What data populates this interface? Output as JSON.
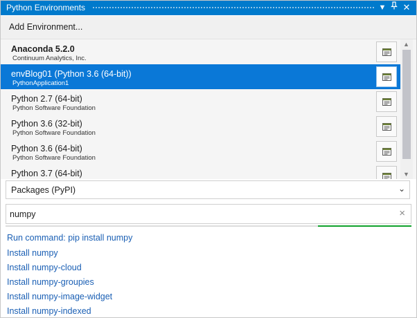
{
  "window": {
    "title": "Python Environments",
    "accent": "#007acc",
    "buttons": [
      "dropdown-icon",
      "pin-icon",
      "close-icon"
    ]
  },
  "add_environment": {
    "label": "Add Environment..."
  },
  "environments": [
    {
      "name": "Anaconda 5.2.0",
      "sub": "Continuum Analytics, Inc.",
      "bold": true,
      "selected": false
    },
    {
      "name": "envBlog01 (Python 3.6 (64-bit))",
      "sub": "PythonApplication1",
      "bold": false,
      "selected": true
    },
    {
      "name": "Python 2.7 (64-bit)",
      "sub": "Python Software Foundation",
      "bold": false,
      "selected": false
    },
    {
      "name": "Python 3.6 (32-bit)",
      "sub": "Python Software Foundation",
      "bold": false,
      "selected": false
    },
    {
      "name": "Python 3.6 (64-bit)",
      "sub": "Python Software Foundation",
      "bold": false,
      "selected": false
    },
    {
      "name": "Python 3.7 (64-bit)",
      "sub": "",
      "bold": false,
      "selected": false
    }
  ],
  "packages_view": {
    "selected": "Packages (PyPI)"
  },
  "search": {
    "value": "numpy",
    "progress": 0.23
  },
  "results": [
    "Run command: pip install numpy",
    "Install numpy",
    "Install numpy-cloud",
    "Install numpy-groupies",
    "Install numpy-image-widget",
    "Install numpy-indexed"
  ]
}
